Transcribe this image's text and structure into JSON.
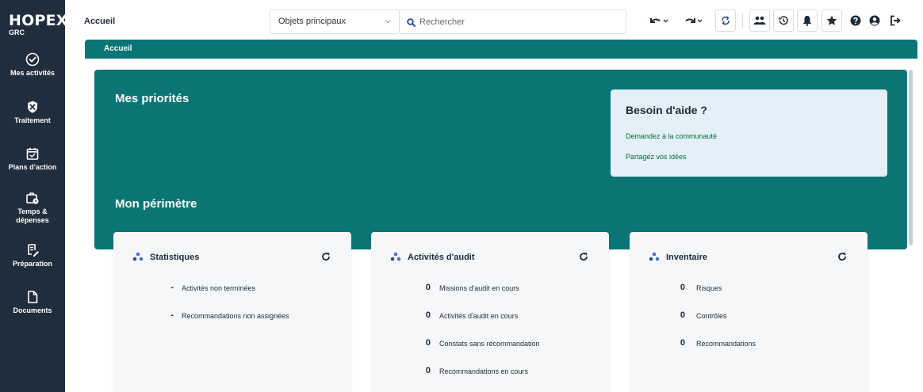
{
  "brand": {
    "title": "HOPEX",
    "subtitle": "GRC"
  },
  "rail": [
    {
      "label": "Mes activités",
      "icon": "check-circle-icon"
    },
    {
      "label": "Traitement",
      "icon": "shield-tools-icon"
    },
    {
      "label": "Plans d'action",
      "icon": "calendar-check-icon"
    },
    {
      "label": "Temps & dépenses",
      "icon": "briefcase-clock-icon"
    },
    {
      "label": "Préparation",
      "icon": "document-edit-icon"
    },
    {
      "label": "Documents",
      "icon": "document-icon"
    }
  ],
  "topbar": {
    "title": "Accueil",
    "select_value": "Objets principaux",
    "search_placeholder": "Rechercher"
  },
  "tab": {
    "label": "Accueil"
  },
  "hero": {
    "priorities_title": "Mes priorités",
    "perimeter_title": "Mon périmètre"
  },
  "help": {
    "title": "Besoin d'aide ?",
    "links": [
      "Demandez à la communauté",
      "Partagez vos idées"
    ]
  },
  "cards": [
    {
      "title": "Statistiques",
      "rows": [
        {
          "value": "-",
          "label": "Activités non terminées"
        },
        {
          "value": "-",
          "label": "Recommandations non assignées"
        }
      ]
    },
    {
      "title": "Activités d'audit",
      "rows": [
        {
          "value": "0",
          "label": "Missions d'audit en cours"
        },
        {
          "value": "0",
          "label": "Activités d'audit en cours"
        },
        {
          "value": "0",
          "label": "Constats sans recommandation"
        },
        {
          "value": "0",
          "label": "Recommandations en cours"
        }
      ]
    },
    {
      "title": "Inventaire",
      "rows": [
        {
          "value": "0",
          "label": "Risques"
        },
        {
          "value": "0",
          "label": "Contrôles"
        },
        {
          "value": "0",
          "label": "Recommandations"
        }
      ]
    }
  ],
  "colors": {
    "rail": "#1f2d3d",
    "teal": "#0b7575",
    "help_bg": "#e4eff8",
    "link": "#0b6a3a",
    "accent_icon": "#4a6fd8"
  }
}
